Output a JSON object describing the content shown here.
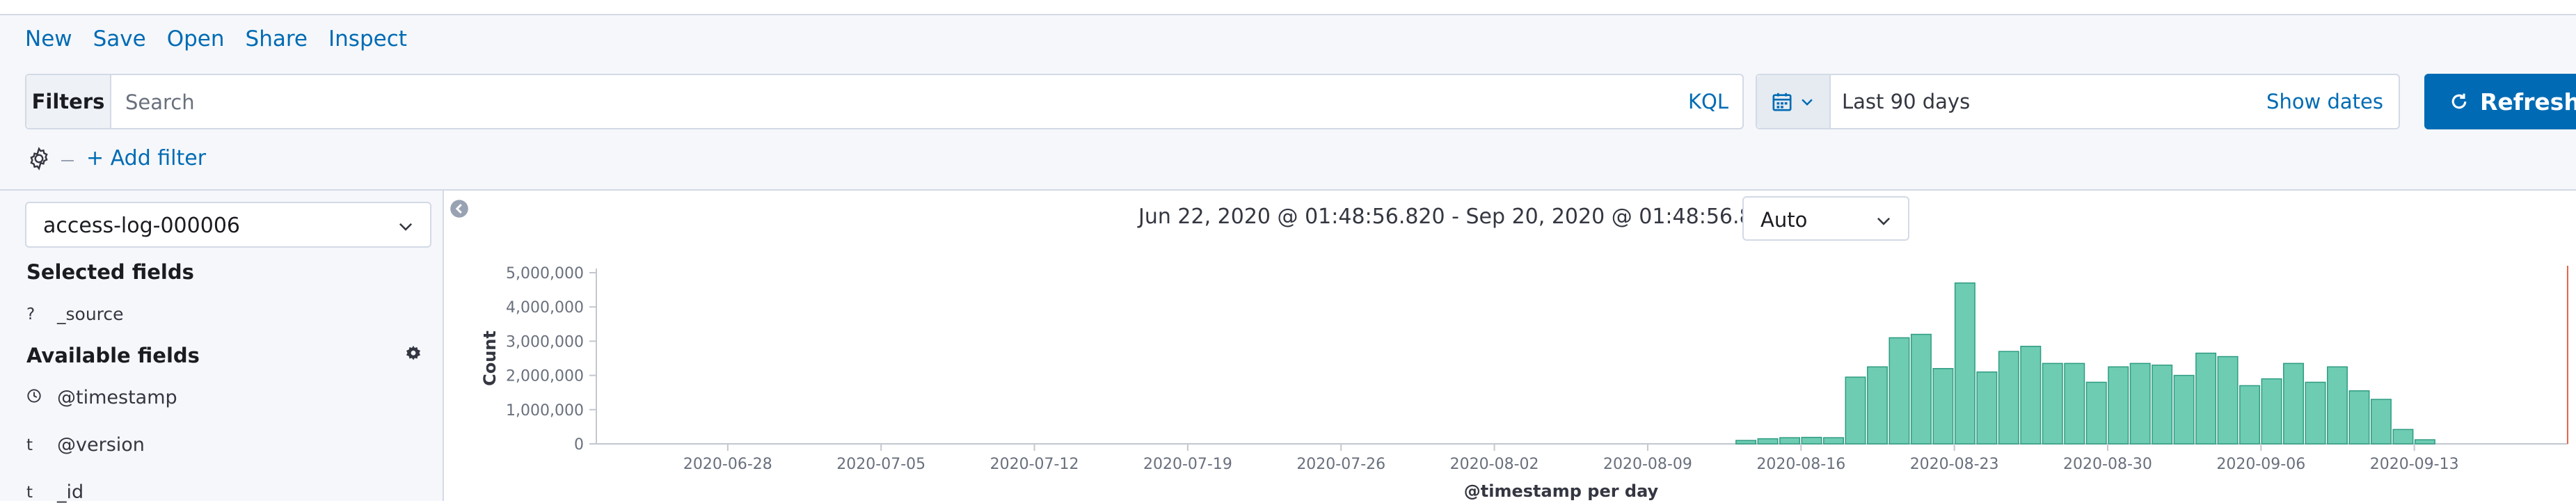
{
  "menu": {
    "new": "New",
    "save": "Save",
    "open": "Open",
    "share": "Share",
    "inspect": "Inspect"
  },
  "query": {
    "filters_label": "Filters",
    "placeholder": "Search",
    "language": "KQL"
  },
  "time": {
    "range_label": "Last 90 days",
    "show_dates": "Show dates",
    "refresh": "Refresh"
  },
  "filterbar": {
    "add_filter": "+ Add filter"
  },
  "sidebar": {
    "index_pattern": "access-log-000006",
    "selected_title": "Selected fields",
    "selected_fields": [
      {
        "type": "?",
        "name": "_source"
      }
    ],
    "available_title": "Available fields",
    "available_fields": [
      {
        "type": "clock-icon",
        "name": "@timestamp"
      },
      {
        "type": "t",
        "name": "@version"
      },
      {
        "type": "t",
        "name": "_id"
      }
    ]
  },
  "histogram": {
    "range_text": "Jun 22, 2020 @ 01:48:56.820 - Sep 20, 2020 @ 01:48:56.820 —",
    "interval": "Auto"
  },
  "colors": {
    "accent": "#006bb4",
    "bar": "#6dccb1",
    "bar_stroke": "#2f9c83",
    "marker": "#e7664c"
  },
  "chart_data": {
    "type": "bar",
    "xlabel": "@timestamp per day",
    "ylabel": "Count",
    "ylim": [
      0,
      5000000
    ],
    "yticks": [
      {
        "value": 0,
        "label": "0"
      },
      {
        "value": 1000000,
        "label": "1,000,000"
      },
      {
        "value": 2000000,
        "label": "2,000,000"
      },
      {
        "value": 3000000,
        "label": "3,000,000"
      },
      {
        "value": 4000000,
        "label": "4,000,000"
      },
      {
        "value": 5000000,
        "label": "5,000,000"
      }
    ],
    "xrange": [
      "2020-06-22",
      "2020-09-20"
    ],
    "xticks": [
      "2020-06-28",
      "2020-07-05",
      "2020-07-12",
      "2020-07-19",
      "2020-07-26",
      "2020-08-02",
      "2020-08-09",
      "2020-08-16",
      "2020-08-23",
      "2020-08-30",
      "2020-09-06",
      "2020-09-13"
    ],
    "x": [
      "2020-08-13",
      "2020-08-14",
      "2020-08-15",
      "2020-08-16",
      "2020-08-17",
      "2020-08-18",
      "2020-08-19",
      "2020-08-20",
      "2020-08-21",
      "2020-08-22",
      "2020-08-23",
      "2020-08-24",
      "2020-08-25",
      "2020-08-26",
      "2020-08-27",
      "2020-08-28",
      "2020-08-29",
      "2020-08-30",
      "2020-08-31",
      "2020-09-01",
      "2020-09-02",
      "2020-09-03",
      "2020-09-04",
      "2020-09-05",
      "2020-09-06",
      "2020-09-07",
      "2020-09-08",
      "2020-09-09",
      "2020-09-10",
      "2020-09-11",
      "2020-09-12",
      "2020-09-13"
    ],
    "values": [
      100000,
      150000,
      180000,
      190000,
      180000,
      1950000,
      2250000,
      3100000,
      3200000,
      2200000,
      4700000,
      2100000,
      2700000,
      2850000,
      2350000,
      2350000,
      1800000,
      2250000,
      2350000,
      2300000,
      2000000,
      2650000,
      2550000,
      1700000,
      1900000,
      2350000,
      1800000,
      2250000,
      1550000,
      1300000,
      420000,
      120000
    ],
    "grid": false
  }
}
